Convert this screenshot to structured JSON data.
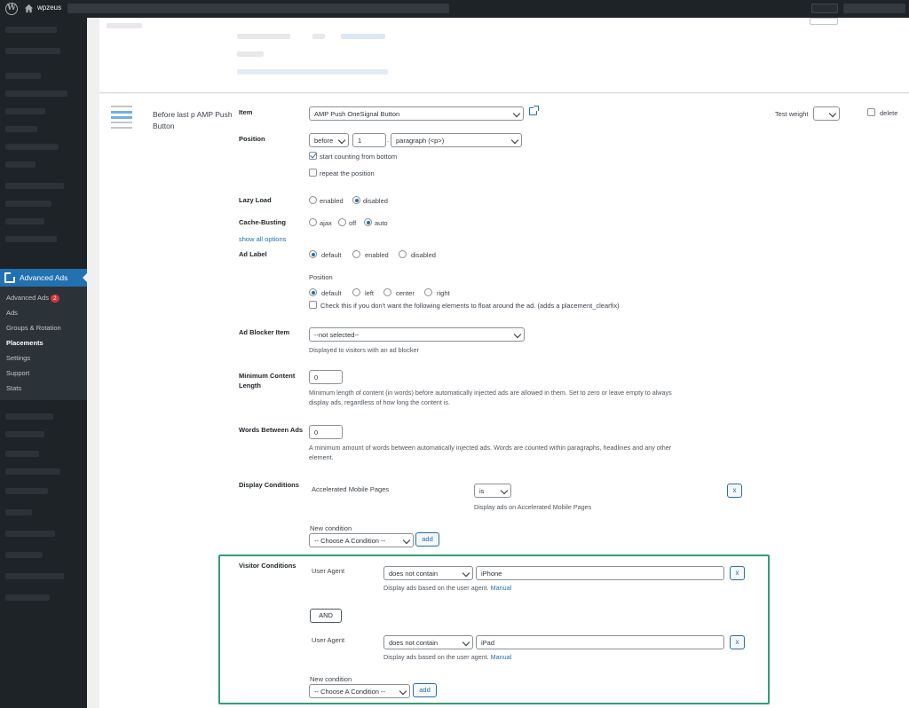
{
  "adminbar": {
    "site_name": "wpzeus"
  },
  "sidebar": {
    "menu_label": "Advanced Ads",
    "submenu": [
      {
        "label": "Advanced Ads",
        "badge": "2"
      },
      {
        "label": "Ads"
      },
      {
        "label": "Groups & Rotation"
      },
      {
        "label": "Placements",
        "current": true
      },
      {
        "label": "Settings"
      },
      {
        "label": "Support"
      },
      {
        "label": "Stats"
      }
    ]
  },
  "placement": {
    "name": "Before last p AMP Push Button",
    "test_weight_label": "Test weight",
    "delete_label": "delete",
    "item": {
      "label": "Item",
      "value": "AMP Push OneSignal Button"
    },
    "position": {
      "label": "Position",
      "where": "before",
      "index": "1",
      "comma": ".",
      "element": "paragraph (<p>)",
      "start_from_bottom": "start counting from bottom",
      "repeat": "repeat the position"
    },
    "lazy_load": {
      "label": "Lazy Load",
      "enabled": "enabled",
      "disabled": "disabled"
    },
    "cache_busting": {
      "label": "Cache-Busting",
      "ajax": "ajax",
      "off": "off",
      "auto": "auto"
    },
    "show_all_options": "show all options",
    "ad_label": {
      "label": "Ad Label",
      "default": "default",
      "enabled": "enabled",
      "disabled": "disabled",
      "position_label": "Position",
      "pos_default": "default",
      "pos_left": "left",
      "pos_center": "center",
      "pos_right": "right",
      "clearfix": "Check this if you don't want the following elements to float around the ad. (adds a placement_clearfix)"
    },
    "ad_blocker": {
      "label": "Ad Blocker Item",
      "value": "--not selected--",
      "desc": "Displayed to visitors with an ad blocker"
    },
    "min_content": {
      "label": "Minimum Content Length",
      "value": "0",
      "desc": "Minimum length of content (in words) before automatically injected ads are allowed in them. Set to zero or leave empty to always display ads, regardless of how long the content is."
    },
    "words_between": {
      "label": "Words Between Ads",
      "value": "0",
      "desc": "A minimum amount of words between automatically injected ads. Words are counted within paragraphs, headlines and any other element."
    },
    "display_conditions": {
      "label": "Display Conditions",
      "condition": "Accelerated Mobile Pages",
      "operator": "is",
      "desc": "Display ads on Accelerated Mobile Pages",
      "remove": "x",
      "new_condition_label": "New condition",
      "choose": "-- Choose A Condition --",
      "add": "add"
    },
    "visitor_conditions": {
      "label": "Visitor Conditions",
      "conditions": [
        {
          "name": "User Agent",
          "operator": "does not contain",
          "value": "iPhone",
          "desc": "Display ads based on the user agent.",
          "link": "Manual",
          "remove": "x"
        },
        {
          "name": "User Agent",
          "operator": "does not contain",
          "value": "iPad",
          "desc": "Display ads based on the user agent.",
          "link": "Manual",
          "remove": "x"
        }
      ],
      "connector": "AND",
      "new_condition_label": "New condition",
      "choose": "-- Choose A Condition --",
      "add": "add"
    }
  }
}
